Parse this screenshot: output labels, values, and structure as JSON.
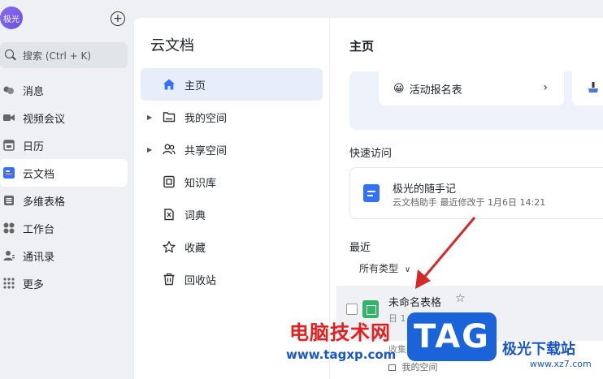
{
  "left_nav": {
    "avatar_text": "极光",
    "search_placeholder": "搜索 (Ctrl + K)",
    "items": [
      {
        "label": "消息",
        "icon": "chat-icon"
      },
      {
        "label": "视频会议",
        "icon": "video-icon"
      },
      {
        "label": "日历",
        "icon": "calendar-icon"
      },
      {
        "label": "云文档",
        "icon": "cloud-doc-icon",
        "active": true
      },
      {
        "label": "多维表格",
        "icon": "table-icon"
      },
      {
        "label": "工作台",
        "icon": "workbench-icon"
      },
      {
        "label": "通讯录",
        "icon": "contacts-icon"
      },
      {
        "label": "更多",
        "icon": "more-icon"
      }
    ]
  },
  "mid_panel": {
    "title": "云文档",
    "items": [
      {
        "label": "主页",
        "icon": "home-icon",
        "active": true,
        "expandable": false
      },
      {
        "label": "我的空间",
        "icon": "folder-icon",
        "expandable": true
      },
      {
        "label": "共享空间",
        "icon": "shared-users-icon",
        "expandable": true
      },
      {
        "label": "知识库",
        "icon": "knowledge-icon",
        "expandable": false
      },
      {
        "label": "词典",
        "icon": "dictionary-icon",
        "expandable": false
      },
      {
        "label": "收藏",
        "icon": "star-icon",
        "expandable": false
      },
      {
        "label": "回收站",
        "icon": "trash-icon",
        "expandable": false
      }
    ]
  },
  "main": {
    "title": "主页",
    "banner_card": {
      "emoji": "😀",
      "label": "活动报名表",
      "chevron": "›"
    },
    "quick_access": {
      "heading": "快速访问",
      "item_title": "极光的随手记",
      "item_sub": "云文档助手 最近修改于 1月6日 14:21"
    },
    "recent": {
      "heading": "最近",
      "filter_label": "所有类型",
      "rows": [
        {
          "title": "未命名表格",
          "sub": "日 1"
        },
        {
          "title": "",
          "sub": "收集表",
          "location": "我的空间"
        }
      ]
    }
  },
  "watermarks": {
    "cn_text": "电脑技术网",
    "url_text": "www.tagxp.com",
    "tag_text": "TAG",
    "logo_text": "极光下载站",
    "logo_url": "www.xz7.com"
  },
  "colors": {
    "accent": "#3370ff",
    "sheet_green": "#34b36b",
    "arrow_red": "#d42a2a",
    "active_nav_bg": "#e8edfa"
  }
}
